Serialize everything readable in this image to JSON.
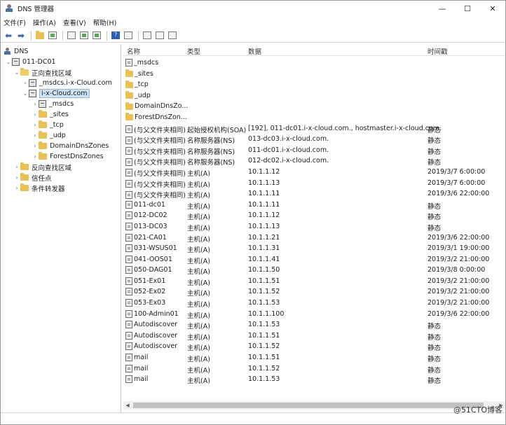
{
  "window": {
    "title": "DNS 管理器",
    "minimize": "—",
    "maximize": "☐",
    "close": "✕"
  },
  "menu": [
    "文件(F)",
    "操作(A)",
    "查看(V)",
    "帮助(H)"
  ],
  "tree": {
    "root": "DNS",
    "server": "011-DC01",
    "forward": "正向查找区域",
    "zone1": "_msdcs.i-x-Cloud.com",
    "zone2": "i-x-Cloud.com",
    "sub": [
      "_msdcs",
      "_sites",
      "_tcp",
      "_udp",
      "DomainDnsZones",
      "ForestDnsZones"
    ],
    "reverse": "反向查找区域",
    "trust": "信任点",
    "forwarders": "条件转发器"
  },
  "columns": {
    "name": "名称",
    "type": "类型",
    "data": "数据",
    "timestamp": "时间戳"
  },
  "rows": [
    {
      "name": "_msdcs",
      "type": "",
      "data": "",
      "ts": "",
      "icon": "zone"
    },
    {
      "name": "_sites",
      "type": "",
      "data": "",
      "ts": "",
      "icon": "folder"
    },
    {
      "name": "_tcp",
      "type": "",
      "data": "",
      "ts": "",
      "icon": "folder"
    },
    {
      "name": "_udp",
      "type": "",
      "data": "",
      "ts": "",
      "icon": "folder"
    },
    {
      "name": "DomainDnsZo...",
      "type": "",
      "data": "",
      "ts": "",
      "icon": "folder"
    },
    {
      "name": "ForestDnsZon...",
      "type": "",
      "data": "",
      "ts": "",
      "icon": "folder"
    },
    {
      "name": "(与父文件夹相同)",
      "type": "起始授权机构(SOA)",
      "data": "[192], 011-dc01.i-x-cloud.com., hostmaster.i-x-cloud.com.",
      "ts": "静态",
      "icon": "record"
    },
    {
      "name": "(与父文件夹相同)",
      "type": "名称服务器(NS)",
      "data": "013-dc03.i-x-cloud.com.",
      "ts": "静态",
      "icon": "record"
    },
    {
      "name": "(与父文件夹相同)",
      "type": "名称服务器(NS)",
      "data": "011-dc01.i-x-cloud.com.",
      "ts": "静态",
      "icon": "record"
    },
    {
      "name": "(与父文件夹相同)",
      "type": "名称服务器(NS)",
      "data": "012-dc02.i-x-cloud.com.",
      "ts": "静态",
      "icon": "record"
    },
    {
      "name": "(与父文件夹相同)",
      "type": "主机(A)",
      "data": "10.1.1.12",
      "ts": "2019/3/7 6:00:00",
      "icon": "record"
    },
    {
      "name": "(与父文件夹相同)",
      "type": "主机(A)",
      "data": "10.1.1.13",
      "ts": "2019/3/7 6:00:00",
      "icon": "record"
    },
    {
      "name": "(与父文件夹相同)",
      "type": "主机(A)",
      "data": "10.1.1.11",
      "ts": "2019/3/6 22:00:00",
      "icon": "record"
    },
    {
      "name": "011-dc01",
      "type": "主机(A)",
      "data": "10.1.1.11",
      "ts": "静态",
      "icon": "record"
    },
    {
      "name": "012-DC02",
      "type": "主机(A)",
      "data": "10.1.1.12",
      "ts": "静态",
      "icon": "record"
    },
    {
      "name": "013-DC03",
      "type": "主机(A)",
      "data": "10.1.1.13",
      "ts": "静态",
      "icon": "record"
    },
    {
      "name": "021-CA01",
      "type": "主机(A)",
      "data": "10.1.1.21",
      "ts": "2019/3/6 22:00:00",
      "icon": "record"
    },
    {
      "name": "031-WSUS01",
      "type": "主机(A)",
      "data": "10.1.1.31",
      "ts": "2019/3/1 19:00:00",
      "icon": "record"
    },
    {
      "name": "041-OOS01",
      "type": "主机(A)",
      "data": "10.1.1.41",
      "ts": "2019/3/2 21:00:00",
      "icon": "record"
    },
    {
      "name": "050-DAG01",
      "type": "主机(A)",
      "data": "10.1.1.50",
      "ts": "2019/3/8 0:00:00",
      "icon": "record"
    },
    {
      "name": "051-Ex01",
      "type": "主机(A)",
      "data": "10.1.1.51",
      "ts": "2019/3/2 21:00:00",
      "icon": "record"
    },
    {
      "name": "052-Ex02",
      "type": "主机(A)",
      "data": "10.1.1.52",
      "ts": "2019/3/2 21:00:00",
      "icon": "record"
    },
    {
      "name": "053-Ex03",
      "type": "主机(A)",
      "data": "10.1.1.53",
      "ts": "2019/3/2 21:00:00",
      "icon": "record"
    },
    {
      "name": "100-Admin01",
      "type": "主机(A)",
      "data": "10.1.1.100",
      "ts": "2019/3/6 22:00:00",
      "icon": "record"
    },
    {
      "name": "Autodiscover",
      "type": "主机(A)",
      "data": "10.1.1.53",
      "ts": "静态",
      "icon": "record"
    },
    {
      "name": "Autodiscover",
      "type": "主机(A)",
      "data": "10.1.1.51",
      "ts": "静态",
      "icon": "record"
    },
    {
      "name": "Autodiscover",
      "type": "主机(A)",
      "data": "10.1.1.52",
      "ts": "静态",
      "icon": "record"
    },
    {
      "name": "mail",
      "type": "主机(A)",
      "data": "10.1.1.51",
      "ts": "静态",
      "icon": "record"
    },
    {
      "name": "mail",
      "type": "主机(A)",
      "data": "10.1.1.52",
      "ts": "静态",
      "icon": "record"
    },
    {
      "name": "mail",
      "type": "主机(A)",
      "data": "10.1.1.53",
      "ts": "静态",
      "icon": "record"
    }
  ],
  "watermark": "@51CTO博客"
}
